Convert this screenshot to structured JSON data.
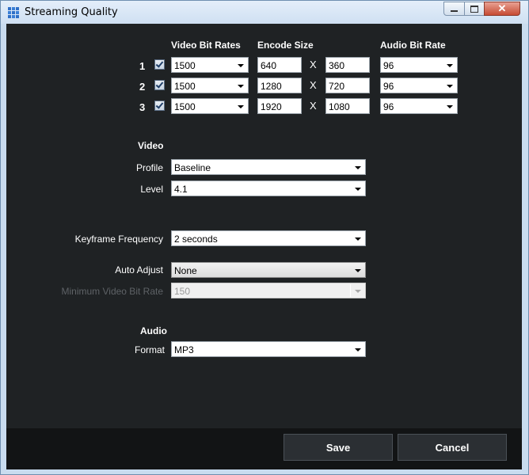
{
  "window": {
    "title": "Streaming Quality"
  },
  "headers": {
    "video_bit_rates": "Video Bit Rates",
    "encode_size": "Encode Size",
    "audio_bit_rate": "Audio Bit Rate"
  },
  "streams": [
    {
      "index": "1",
      "enabled": true,
      "video_bit_rate": "1500",
      "width": "640",
      "height": "360",
      "audio_bit_rate": "96"
    },
    {
      "index": "2",
      "enabled": true,
      "video_bit_rate": "1500",
      "width": "1280",
      "height": "720",
      "audio_bit_rate": "96"
    },
    {
      "index": "3",
      "enabled": true,
      "video_bit_rate": "1500",
      "width": "1920",
      "height": "1080",
      "audio_bit_rate": "96"
    }
  ],
  "size_separator": "X",
  "video": {
    "section_label": "Video",
    "profile_label": "Profile",
    "profile_value": "Baseline",
    "level_label": "Level",
    "level_value": "4.1"
  },
  "keyframe": {
    "label": "Keyframe Frequency",
    "value": "2 seconds"
  },
  "auto_adjust": {
    "label": "Auto Adjust",
    "value": "None"
  },
  "min_video_bit_rate": {
    "label": "Minimum Video Bit Rate",
    "value": "150",
    "disabled": true
  },
  "audio": {
    "section_label": "Audio",
    "format_label": "Format",
    "format_value": "MP3"
  },
  "buttons": {
    "save": "Save",
    "cancel": "Cancel"
  },
  "colors": {
    "background": "#1f2224",
    "footer": "#121415",
    "button": "#2b2f33",
    "text": "#ffffff"
  }
}
